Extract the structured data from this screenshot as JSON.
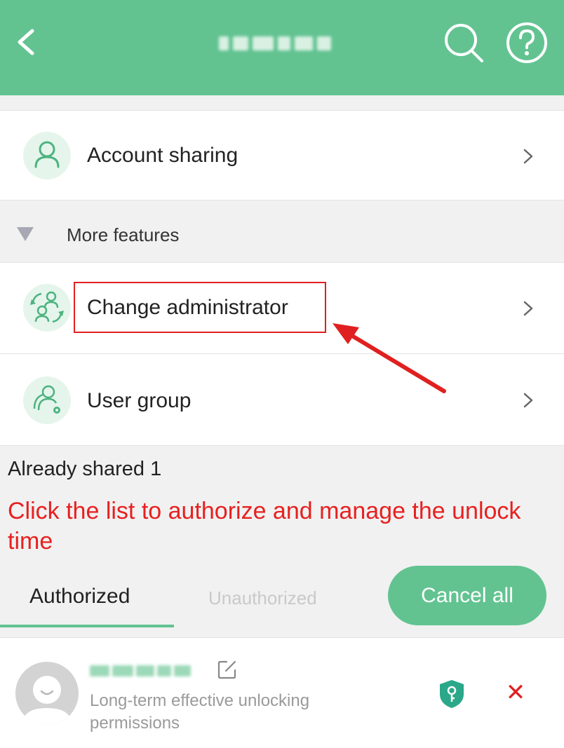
{
  "header": {
    "title_obscured": true,
    "back_icon": "back-arrow-icon",
    "search_icon": "search-icon",
    "help_icon": "help-icon",
    "color": "#62c391"
  },
  "menu": {
    "account_sharing": "Account sharing",
    "more_features": "More features",
    "change_administrator": "Change administrator",
    "user_group": "User group"
  },
  "shared_section": {
    "already_shared": "Already shared 1",
    "hint": "Click the list to authorize and manage the unlock time"
  },
  "tabs": {
    "authorized": "Authorized",
    "unauthorized": "Unauthorized",
    "active": "Authorized"
  },
  "cancel_all": "Cancel all",
  "user": {
    "name_obscured": true,
    "permission": "Long-term effective unlocking permissions"
  },
  "colors": {
    "accent": "#62c391",
    "annotation": "#e02020"
  }
}
